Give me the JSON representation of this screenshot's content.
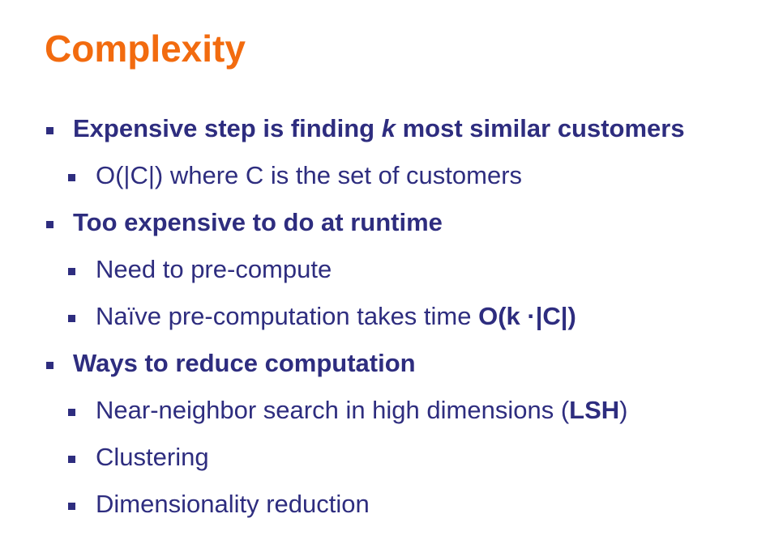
{
  "colors": {
    "title": "#f26b0f",
    "text": "#2e2d7f",
    "bullet": "#2e2d7f",
    "background": "#ffffff"
  },
  "slide": {
    "title": "Complexity",
    "bullets": [
      {
        "level": 1,
        "parts": [
          "Expensive step is finding ",
          "k",
          " most similar customers"
        ]
      },
      {
        "level": 2,
        "parts": [
          "O(|C|) where C is the set of customers"
        ]
      },
      {
        "level": 1,
        "parts": [
          "Too expensive to do at runtime"
        ]
      },
      {
        "level": 2,
        "parts": [
          "Need to pre-compute"
        ]
      },
      {
        "level": 2,
        "parts": [
          "Naïve pre-computation takes time ",
          "O(k ·|C|)"
        ]
      },
      {
        "level": 1,
        "parts": [
          "Ways to reduce computation"
        ]
      },
      {
        "level": 2,
        "parts": [
          "Near-neighbor search in high dimensions (",
          "LSH",
          ")"
        ]
      },
      {
        "level": 2,
        "parts": [
          "Clustering"
        ]
      },
      {
        "level": 2,
        "parts": [
          "Dimensionality reduction"
        ]
      }
    ]
  }
}
